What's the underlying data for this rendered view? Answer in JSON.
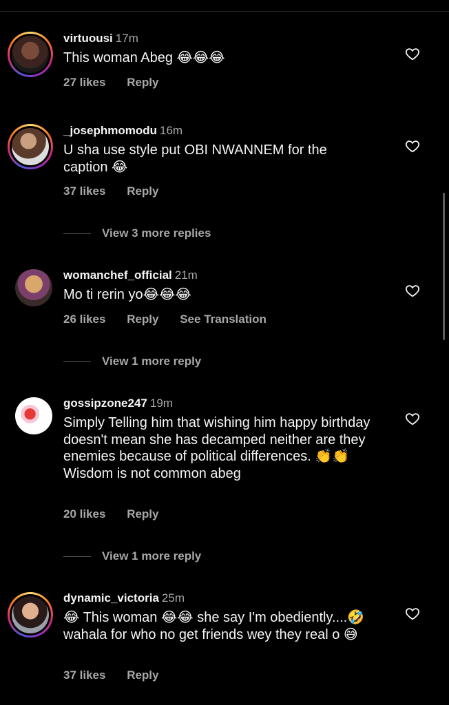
{
  "comments": [
    {
      "username": "virtuousi",
      "time": "17m",
      "text": "This woman Abeg 😂😂😂",
      "likes": "27 likes",
      "reply": "Reply"
    },
    {
      "username": "_josephmomodu",
      "time": "16m",
      "text": "U sha use style put OBI NWANNEM for the caption 😂",
      "likes": "37 likes",
      "reply": "Reply",
      "view_more": "View 3 more replies"
    },
    {
      "username": "womanchef_official",
      "time": "21m",
      "text": "Mo ti rerin yo😂😂😂",
      "likes": "26 likes",
      "reply": "Reply",
      "translate": "See Translation",
      "view_more": "View 1 more reply"
    },
    {
      "username": "gossipzone247",
      "time": "19m",
      "text": "Simply Telling him that wishing him happy birthday doesn't mean she has decamped neither are they enemies because of political differences. 👏👏 Wisdom is not common abeg",
      "likes": "20 likes",
      "reply": "Reply",
      "view_more": "View 1 more reply"
    },
    {
      "username": "dynamic_victoria",
      "time": "25m",
      "text": "😂 This woman 😂😂 she say I'm obediently....🤣 wahala for who no get friends wey they real o 😅",
      "likes": "37 likes",
      "reply": "Reply"
    }
  ],
  "colors": {
    "background": "#000000",
    "text": "#f5f5f5",
    "muted": "#a8a8a8"
  },
  "icons": {
    "like": "heart-outline-icon"
  }
}
